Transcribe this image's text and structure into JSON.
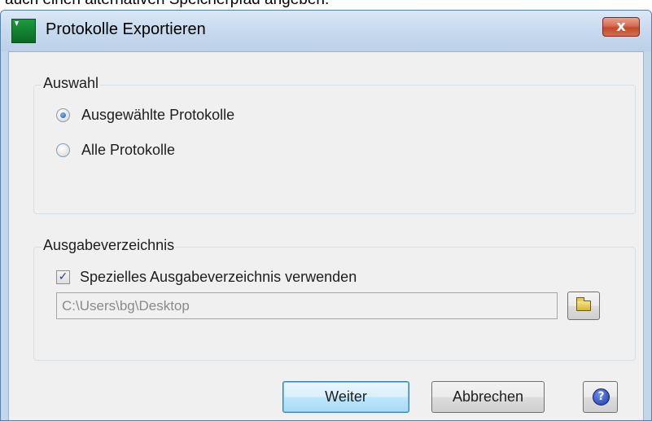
{
  "caption_text": "auch einen alternativen Speicherpfad angeben.",
  "window": {
    "title": "Protokolle Exportieren",
    "close_glyph": "x",
    "app_icon": "green-app-icon"
  },
  "auswahl": {
    "title": "Auswahl",
    "options": [
      {
        "label": "Ausgewählte Protokolle",
        "checked": true
      },
      {
        "label": "Alle Protokolle",
        "checked": false
      }
    ]
  },
  "ausgabe": {
    "title": "Ausgabeverzeichnis",
    "checkbox_label": "Spezielles Ausgabeverzeichnis verwenden",
    "checkbox_checked": true,
    "checkbox_glyph": "✓",
    "path_value": "C:\\Users\\bg\\Desktop",
    "browse_icon": "folder-icon"
  },
  "buttons": {
    "weiter": "Weiter",
    "abbrechen": "Abbrechen",
    "help_glyph": "?"
  }
}
